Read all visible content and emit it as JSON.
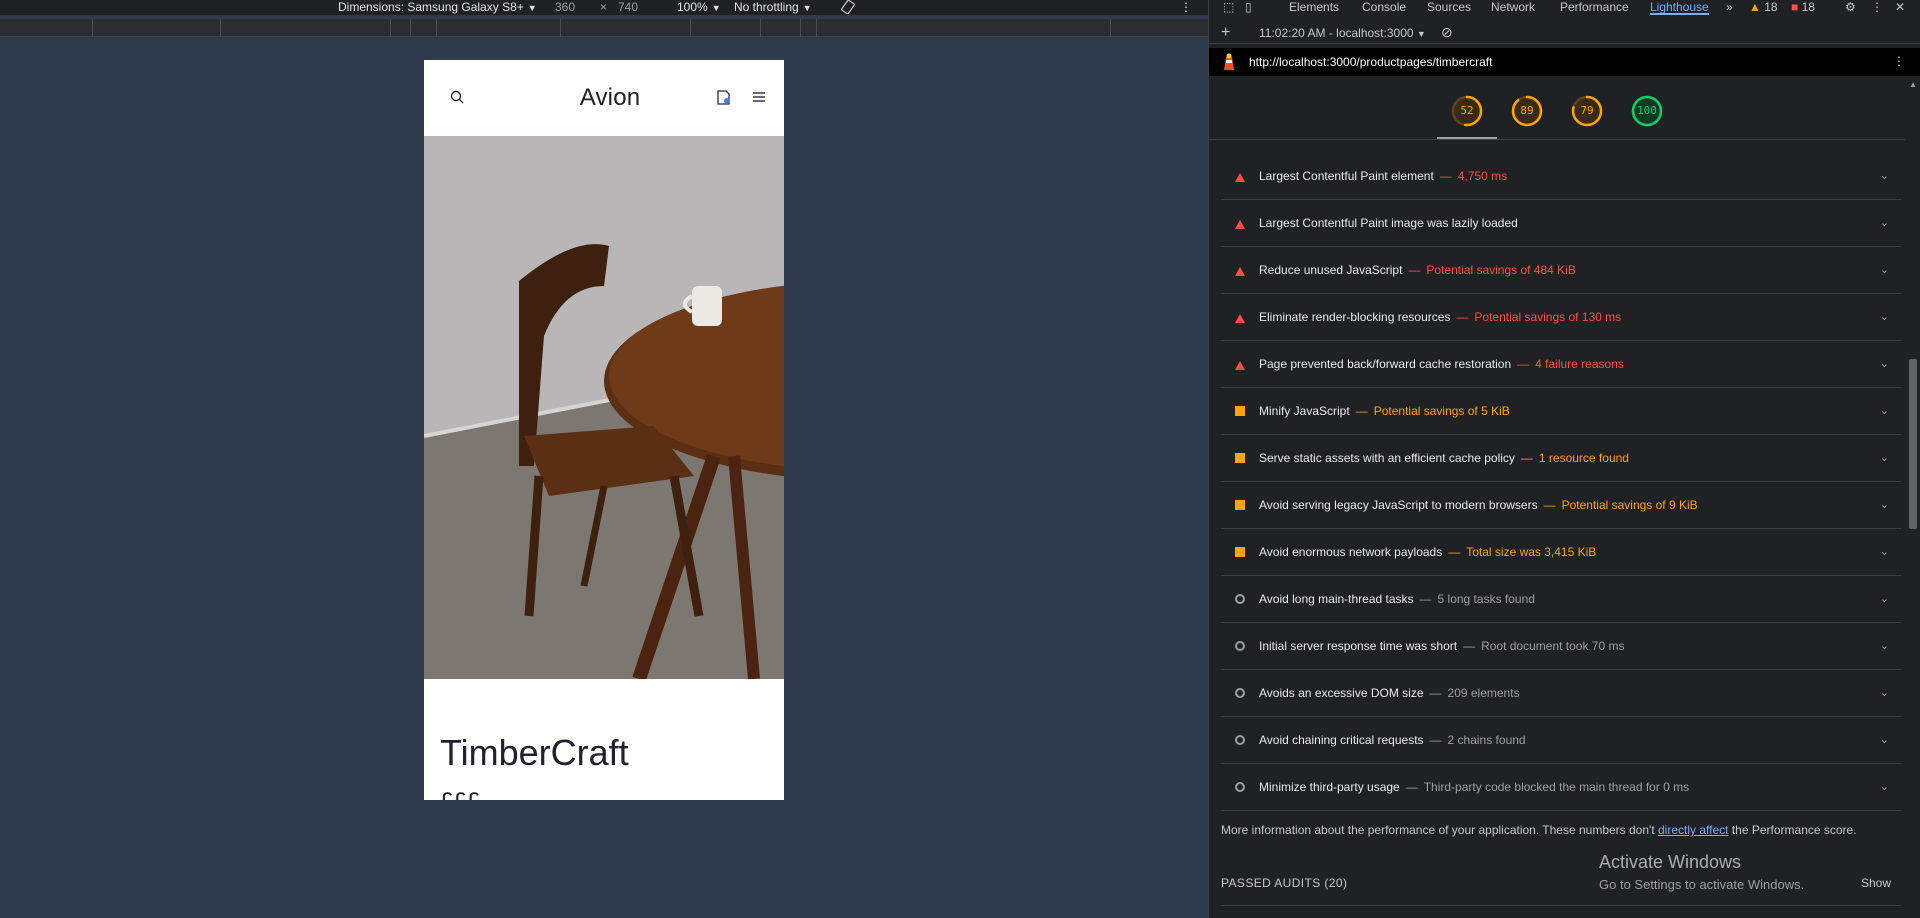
{
  "device_toolbar": {
    "dimensions_label": "Dimensions: Samsung Galaxy S8+",
    "width": "360",
    "times": "×",
    "height": "740",
    "zoom": "100%",
    "throttling": "No throttling"
  },
  "phone": {
    "brand": "Avion",
    "product_title": "TimberCraft",
    "price_peek": "£££"
  },
  "devtools": {
    "tabs": [
      "Elements",
      "Console",
      "Sources",
      "Network",
      "Performance",
      "Lighthouse"
    ],
    "active_tab": "Lighthouse",
    "more_tabs": "»",
    "warnings_count": "18",
    "issues_count": "18",
    "report_time": "11:02:20 AM - localhost:3000",
    "url": "http://localhost:3000/productpages/timbercraft",
    "scores": [
      {
        "value": "52",
        "color": "#ffa400"
      },
      {
        "value": "89",
        "color": "#ffa400"
      },
      {
        "value": "79",
        "color": "#ffa400"
      },
      {
        "value": "100",
        "color": "#0cce6b"
      }
    ],
    "audits": [
      {
        "status": "fail",
        "title": "Largest Contentful Paint element",
        "detail": "4,750 ms"
      },
      {
        "status": "fail",
        "title": "Largest Contentful Paint image was lazily loaded",
        "detail": ""
      },
      {
        "status": "fail",
        "title": "Reduce unused JavaScript",
        "detail": "Potential savings of 484 KiB"
      },
      {
        "status": "fail",
        "title": "Eliminate render-blocking resources",
        "detail": "Potential savings of 130 ms"
      },
      {
        "status": "fail",
        "title": "Page prevented back/forward cache restoration",
        "detail": "4 failure reasons"
      },
      {
        "status": "avg",
        "title": "Minify JavaScript",
        "detail": "Potential savings of 5 KiB"
      },
      {
        "status": "avg",
        "title": "Serve static assets with an efficient cache policy",
        "detail": "1 resource found"
      },
      {
        "status": "avg",
        "title": "Avoid serving legacy JavaScript to modern browsers",
        "detail": "Potential savings of 9 KiB"
      },
      {
        "status": "avg",
        "title": "Avoid enormous network payloads",
        "detail": "Total size was 3,415 KiB"
      },
      {
        "status": "info",
        "title": "Avoid long main-thread tasks",
        "detail": "5 long tasks found"
      },
      {
        "status": "info",
        "title": "Initial server response time was short",
        "detail": "Root document took 70 ms"
      },
      {
        "status": "info",
        "title": "Avoids an excessive DOM size",
        "detail": "209 elements"
      },
      {
        "status": "info",
        "title": "Avoid chaining critical requests",
        "detail": "2 chains found"
      },
      {
        "status": "info",
        "title": "Minimize third-party usage",
        "detail": "Third-party code blocked the main thread for 0 ms"
      }
    ],
    "more_info_pre": "More information about the performance of your application. These numbers don't",
    "more_info_link": "directly affect",
    "more_info_post": "the Performance score.",
    "passed_audits": "PASSED AUDITS (20)",
    "show_label": "Show"
  },
  "watermark": {
    "line1": "Activate Windows",
    "line2": "Go to Settings to activate Windows."
  },
  "icons": [
    "search-icon",
    "cart-icon",
    "menu-icon",
    "rotate-icon",
    "kebab-icon",
    "inspect-icon",
    "device-toggle-icon",
    "settings-icon",
    "warning-icon",
    "issue-icon",
    "plus-icon",
    "clear-icon",
    "lighthouse-logo-icon",
    "chevron-down-icon"
  ]
}
